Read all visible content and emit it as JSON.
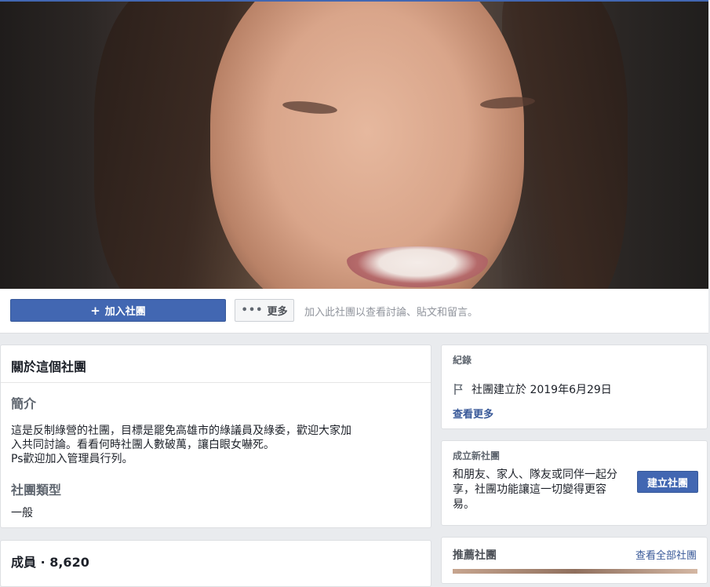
{
  "actions": {
    "join_label": "加入社團",
    "join_icon": "plus-icon",
    "more_label": "更多",
    "more_icon": "ellipsis-icon",
    "join_hint": "加入此社團以查看討論、貼文和留言。"
  },
  "about": {
    "title": "關於這個社團",
    "intro_label": "簡介",
    "description": [
      "這是反制綠營的社團，目標是罷免高雄市的綠議員及綠委，歡迎大家加",
      "入共同討論。看看何時社團人數破萬，讓白眼女嚇死。",
      "Ps歡迎加入管理員行列。"
    ],
    "type_label": "社團類型",
    "type_value": "一般"
  },
  "members": {
    "title": "成員 · 8,620"
  },
  "history": {
    "caption": "紀錄",
    "created_text": "社團建立於 2019年6月29日",
    "flag_icon": "flag-icon",
    "see_more": "查看更多"
  },
  "create_group": {
    "caption": "成立新社團",
    "text": "和朋友、家人、隊友或同伴一起分享，社團功能讓這一切變得更容易。",
    "button_label": "建立社團"
  },
  "suggested": {
    "caption": "推薦社團",
    "see_all": "查看全部社團"
  },
  "colors": {
    "primary": "#4267b2",
    "link": "#385898",
    "background": "#e9ebee"
  }
}
